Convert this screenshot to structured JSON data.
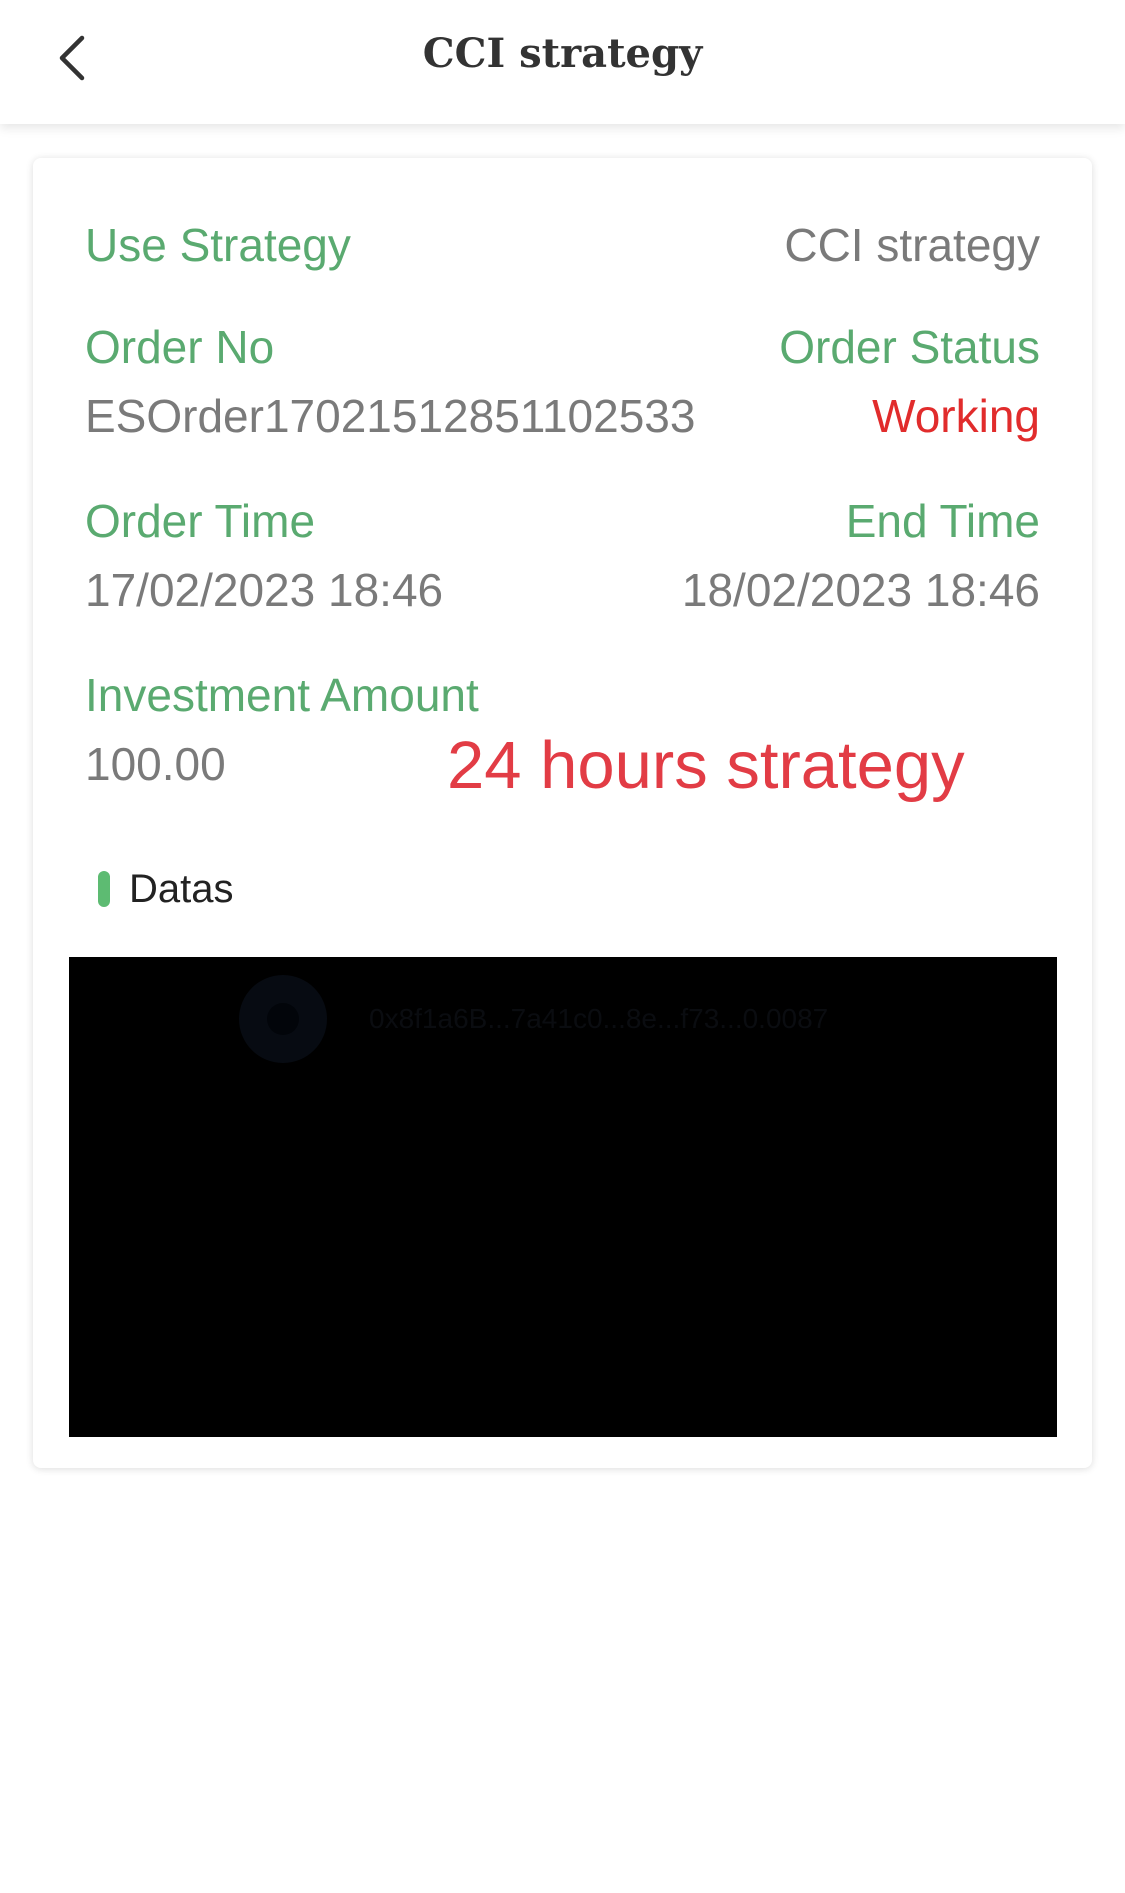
{
  "header": {
    "title": "CCI strategy",
    "back_icon": "chevron-left-icon"
  },
  "card": {
    "use_strategy": {
      "label": "Use Strategy",
      "value": "CCI strategy"
    },
    "order_no": {
      "label": "Order No",
      "value": "ESOrder17021512851102533"
    },
    "order_status": {
      "label": "Order Status",
      "value": "Working"
    },
    "order_time": {
      "label": "Order Time",
      "value": "17/02/2023 18:46"
    },
    "end_time": {
      "label": "End Time",
      "value": "18/02/2023 18:46"
    },
    "investment_amount": {
      "label": "Investment Amount",
      "value": "100.00"
    },
    "promo_text": "24 hours strategy"
  },
  "datas": {
    "title": "Datas",
    "chart_info": "0x8f1a6B...7a41c0...8e...f73...0.0087"
  },
  "colors": {
    "label_green": "#5aaa70",
    "value_gray": "#7a7a7a",
    "status_red": "#e12c2c",
    "promo_red": "#e23c45",
    "marker_green": "#5dbb72",
    "chart_bg": "#000000"
  }
}
